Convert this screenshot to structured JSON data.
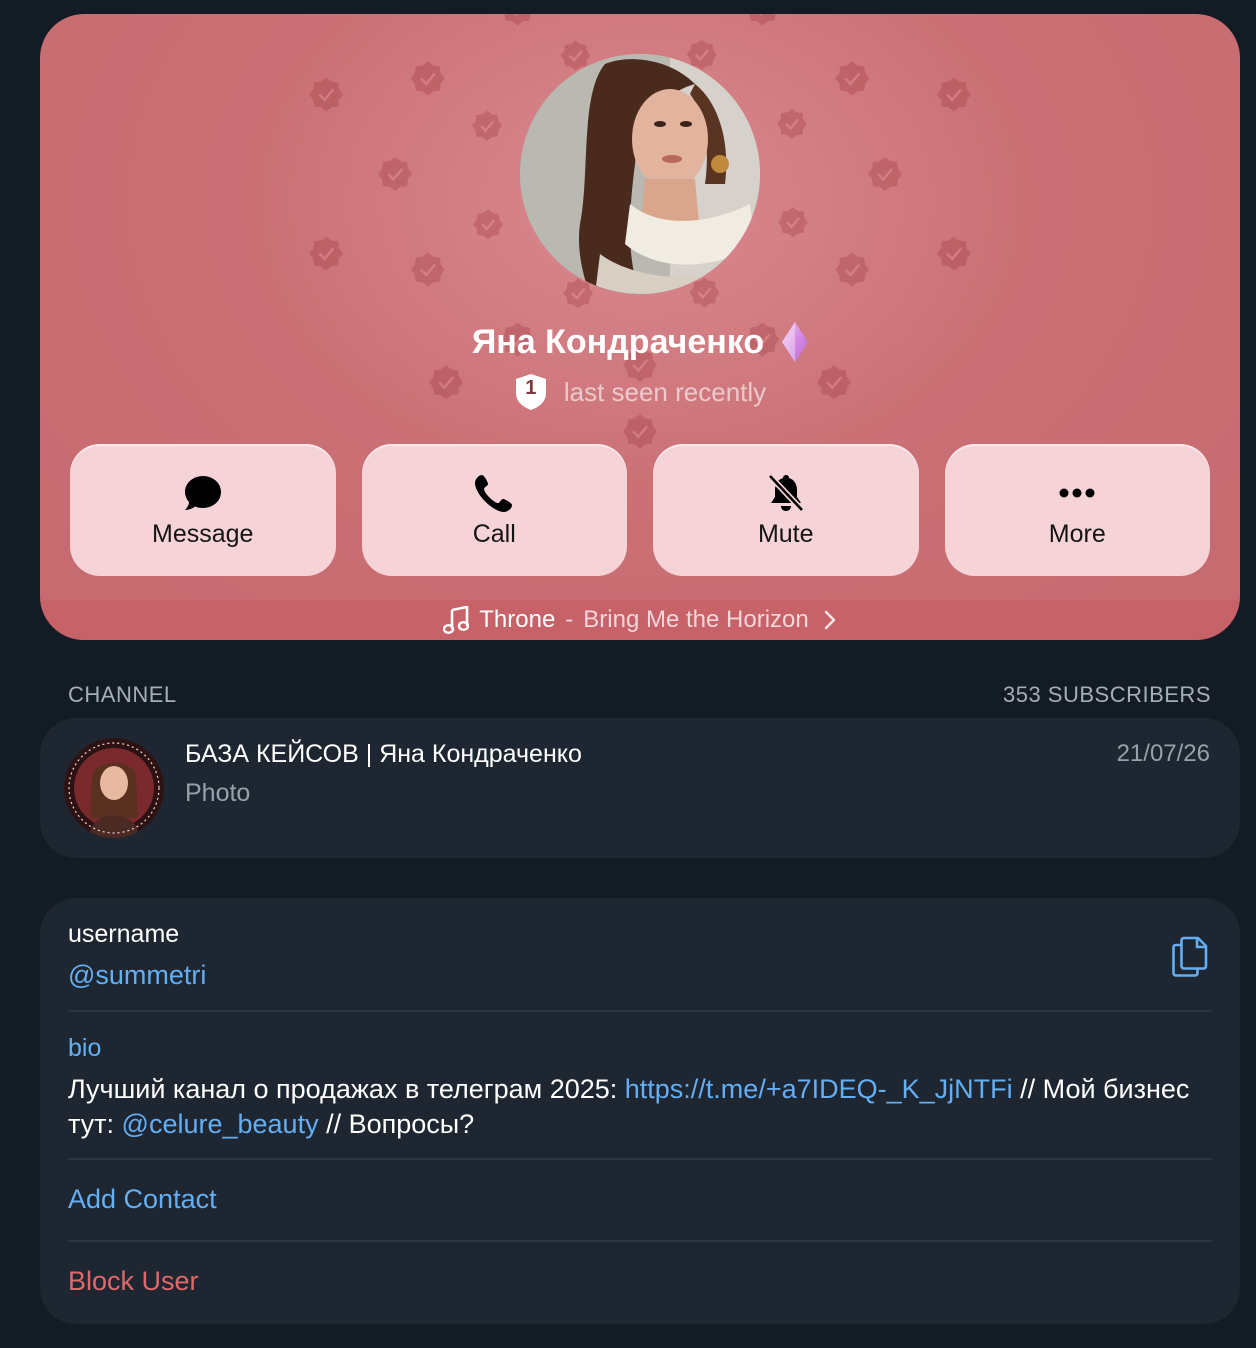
{
  "profile": {
    "name": "Яна Кондраченко",
    "level": "1",
    "status": "last seen recently",
    "premium_icon": "premium-gem-icon",
    "accent_color": "#cb7176"
  },
  "actions": [
    {
      "label": "Message",
      "icon": "message-bubble-icon"
    },
    {
      "label": "Call",
      "icon": "phone-icon"
    },
    {
      "label": "Mute",
      "icon": "bell-slash-icon"
    },
    {
      "label": "More",
      "icon": "more-dots-icon"
    }
  ],
  "music": {
    "title": "Throne",
    "separator": "-",
    "artist": "Bring Me the Horizon"
  },
  "channel": {
    "section_label": "CHANNEL",
    "subscribers": "353 SUBSCRIBERS",
    "title": "БАЗА КЕЙСОВ | Яна Кондраченко",
    "last_message": "Photo",
    "date": "21/07/26"
  },
  "info": {
    "username_label": "username",
    "username": "@summetri",
    "bio_label": "bio",
    "bio_part1": "Лучший канал о продажах в телеграм 2025: ",
    "bio_link": "https://t.me/+a7IDEQ-_K_JjNTFi",
    "bio_part2": " // Мой бизнес тут: ",
    "bio_mention": "@celure_beauty",
    "bio_part3": " // Вопросы?",
    "add_contact": "Add Contact",
    "block_user": "Block User"
  },
  "colors": {
    "background": "#131b24",
    "card": "#1e2731",
    "link": "#64aef4",
    "danger": "#e0686a",
    "button": "#f6d3d6"
  }
}
